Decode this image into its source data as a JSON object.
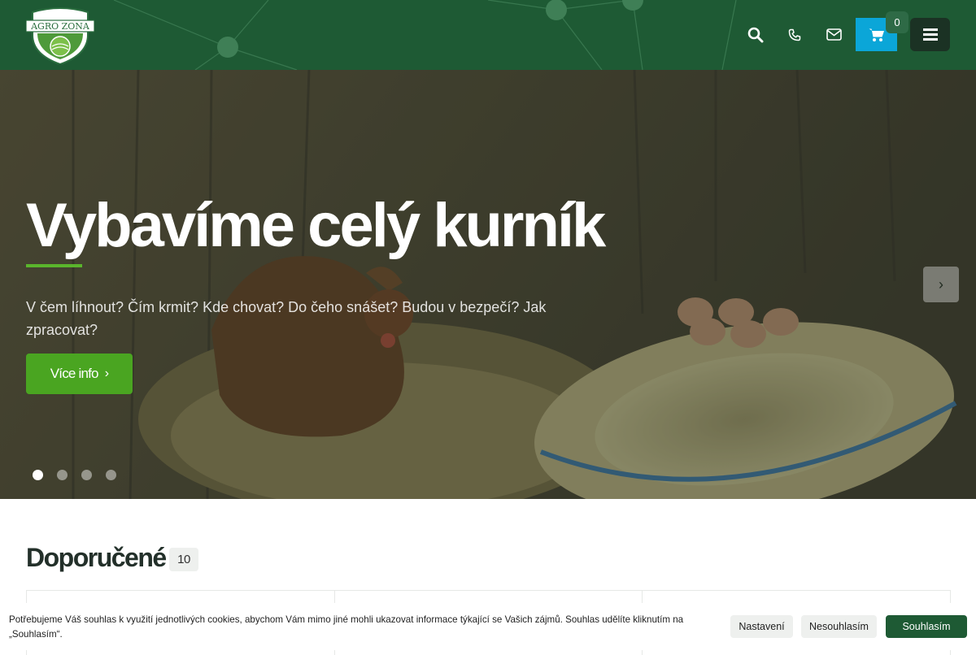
{
  "header": {
    "logo_text": "AGRO ZONA",
    "cart_count": "0",
    "icons": [
      "search-icon",
      "phone-icon",
      "mail-icon",
      "cart-icon",
      "menu-icon"
    ]
  },
  "hero": {
    "title": "Vybavíme celý kurník",
    "subtitle": "V čem líhnout? Čím krmit? Kde chovat? Do čeho snášet? Budou v bezpečí? Jak zpracovat?",
    "button_label": "Více info",
    "slides_count": 4,
    "active_slide": 1
  },
  "section": {
    "title": "Doporučené",
    "count": "10"
  },
  "cookie": {
    "text": "Potřebujeme Váš souhlas k využití jednotlivých cookies, abychom Vám mimo jiné mohli ukazovat informace týkající se Vašich zájmů. Souhlas udělíte kliknutím na „Souhlasím“.",
    "settings_label": "Nastavení",
    "decline_label": "Nesouhlasím",
    "accept_label": "Souhlasím"
  },
  "colors": {
    "header_bg": "#1e5a34",
    "cart_bg": "#0ba6d8",
    "hero_button": "#4aa521",
    "accept_button": "#1e5a34"
  }
}
